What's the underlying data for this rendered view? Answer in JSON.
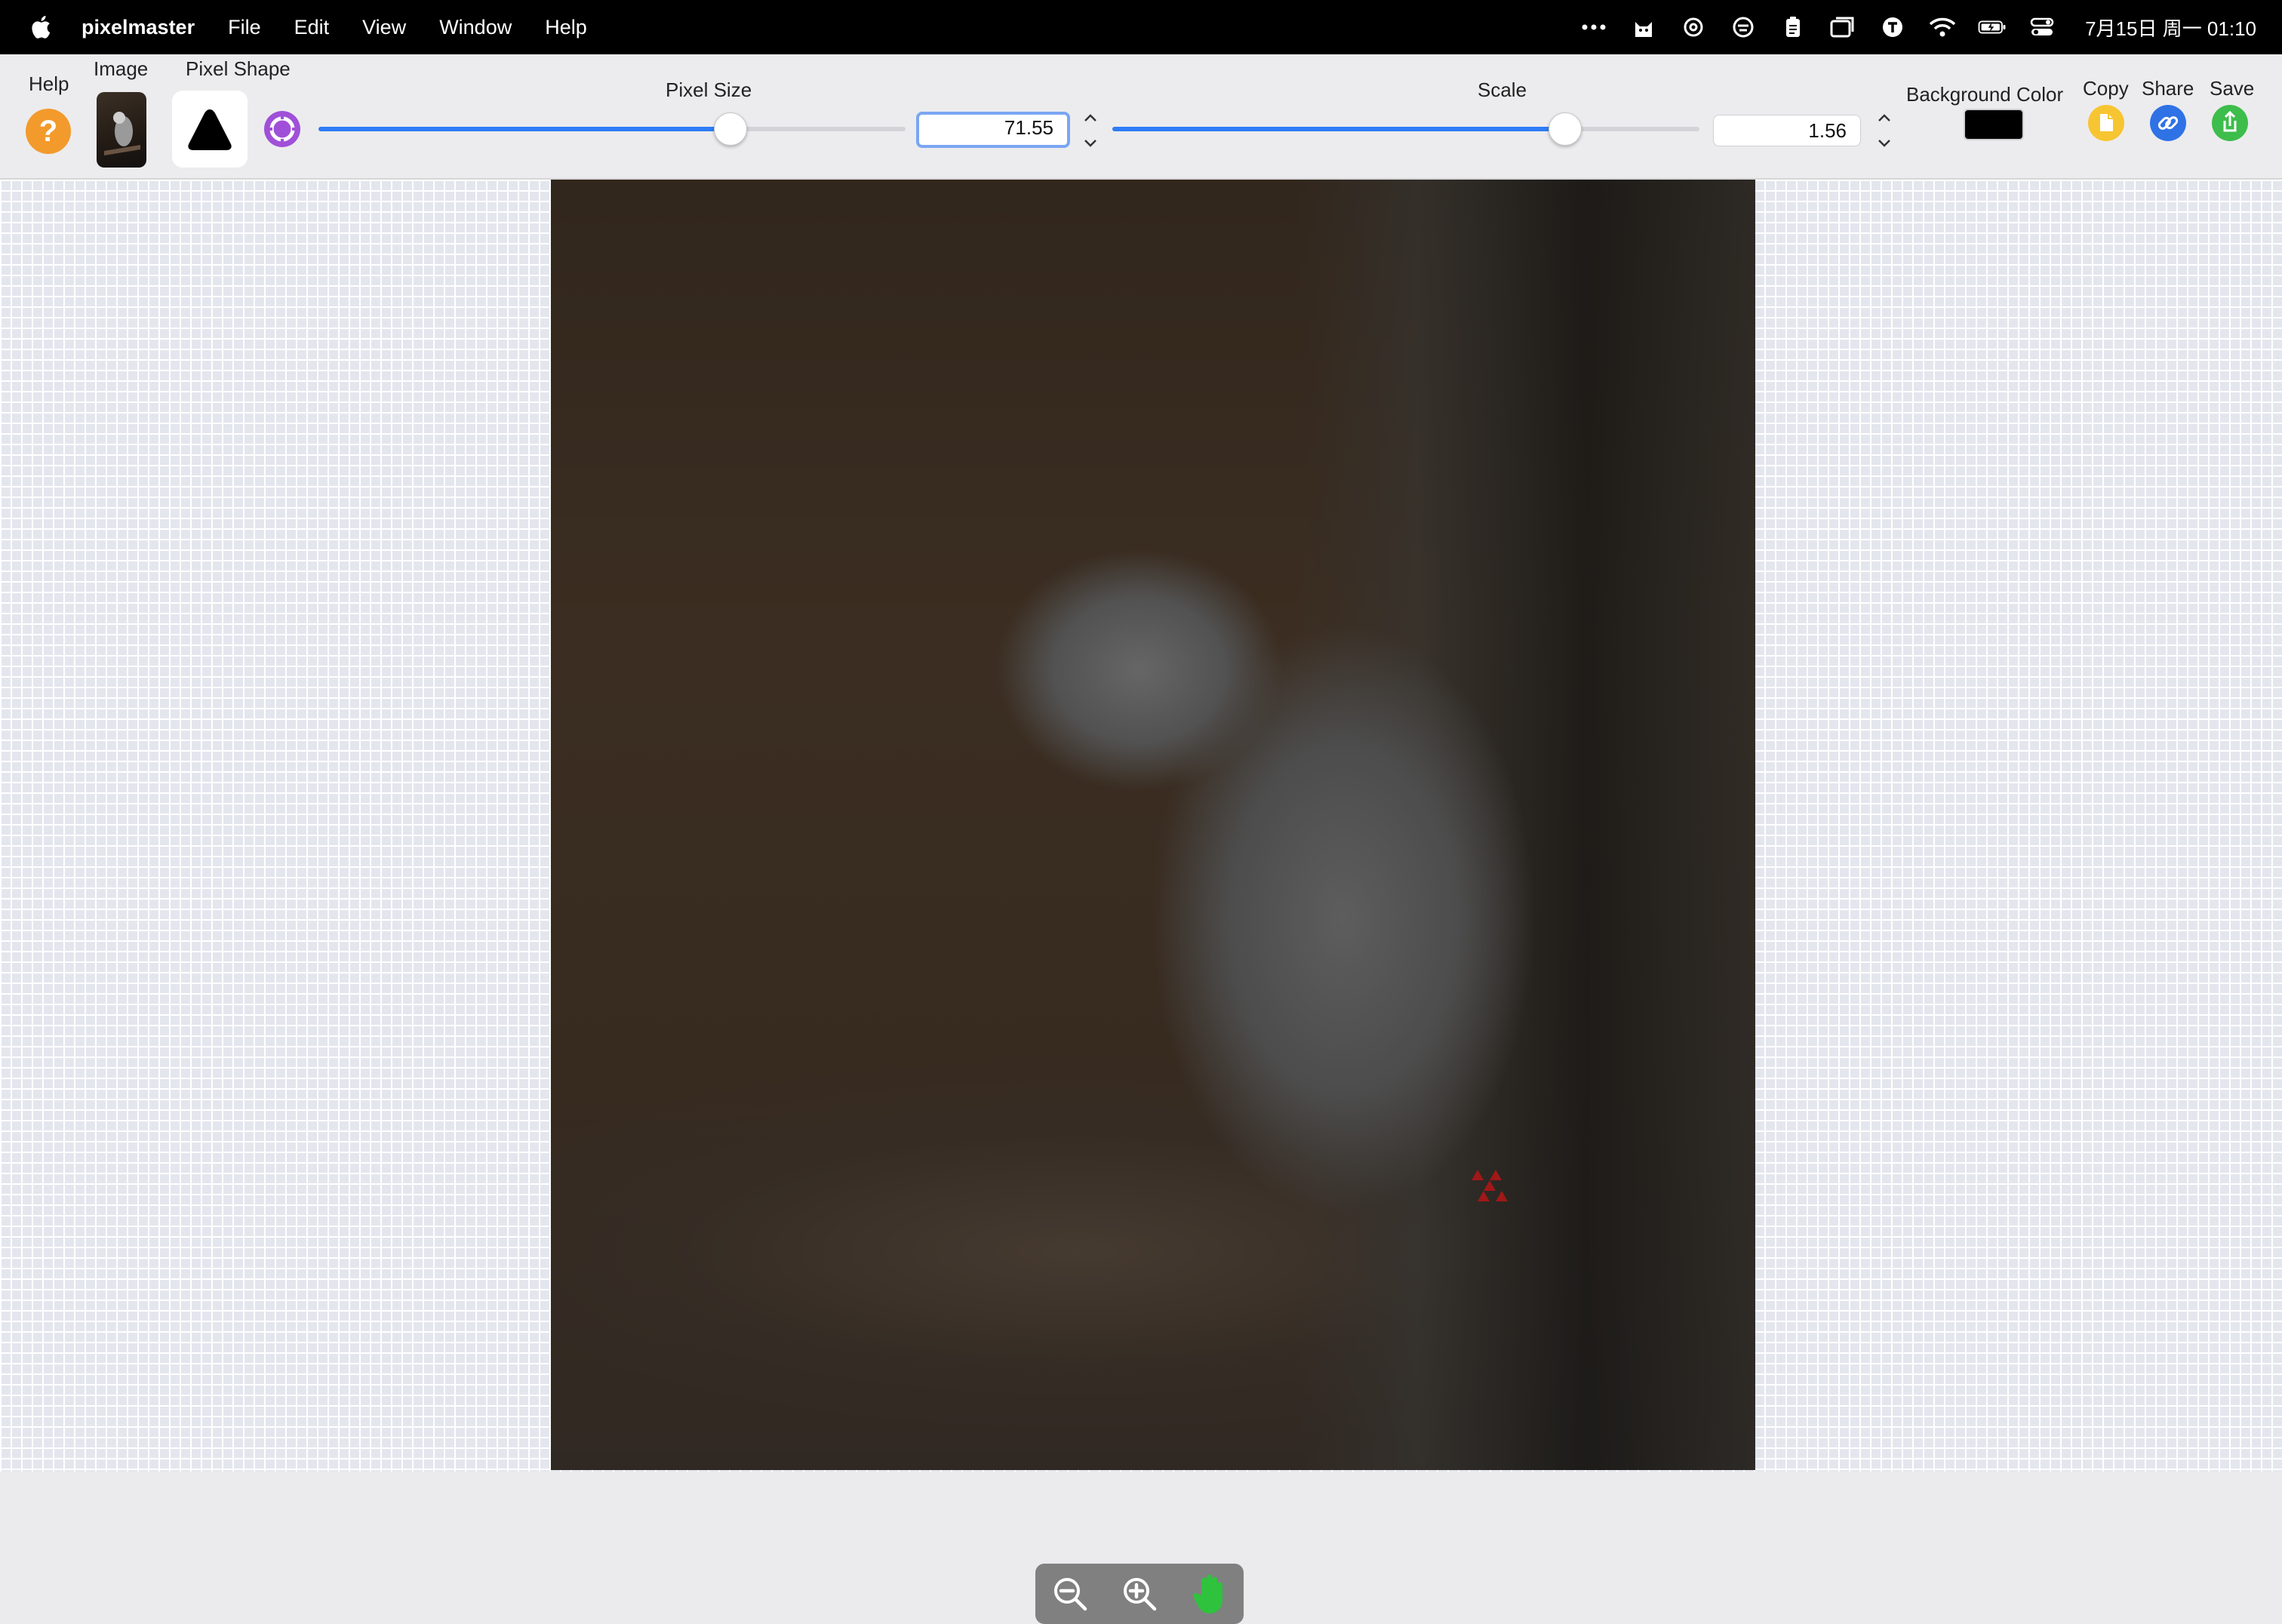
{
  "menubar": {
    "app_name": "pixelmaster",
    "menus": [
      "File",
      "Edit",
      "View",
      "Window",
      "Help"
    ],
    "clock": "7月15日 周一 01:10",
    "status_icons": [
      "more-icon",
      "cat-icon",
      "openai-icon",
      "chat-app-icon",
      "clipboard-icon",
      "window-icon",
      "t-app-icon",
      "wifi-icon",
      "battery-icon",
      "control-center-icon"
    ]
  },
  "toolbar": {
    "help_label": "Help",
    "help_glyph": "?",
    "image_label": "Image",
    "pixel_shape_label": "Pixel Shape",
    "pixel_size_label": "Pixel Size",
    "pixel_size_value": "71.55",
    "pixel_size_fraction": 0.7,
    "scale_label": "Scale",
    "scale_value": "1.56",
    "scale_fraction": 0.77,
    "background_color_label": "Background Color",
    "background_color": "#000000",
    "copy_label": "Copy",
    "share_label": "Share",
    "save_label": "Save",
    "accent": "#2e7cf6",
    "help_color": "#f39a2c",
    "shape_option_color": "#a050d8",
    "copy_color": "#f7c531",
    "share_color": "#2f72e6",
    "save_color": "#3dbd4b"
  },
  "canvas": {
    "zoom_tools": [
      "zoom-out-icon",
      "zoom-in-icon",
      "hand-tool-icon"
    ],
    "hand_color": "#2fc23d"
  }
}
